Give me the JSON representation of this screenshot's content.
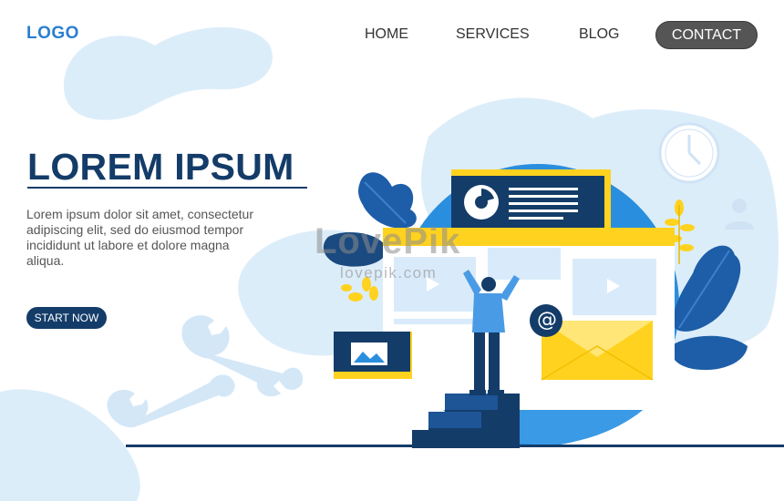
{
  "header": {
    "logo": "LOGO",
    "nav": {
      "home": "HOME",
      "services": "SERVICES",
      "blog": "BLOG",
      "contact": "CONTACT"
    }
  },
  "hero": {
    "title": "LOREM IPSUM",
    "body": "Lorem ipsum dolor sit amet, consectetur adipiscing elit, sed do eiusmod tempor incididunt ut labore et dolore magna aliqua.",
    "cta": "START NOW"
  },
  "illustration": {
    "email_symbol": "@",
    "icons": [
      "wrench-icon",
      "clock-icon",
      "user-icon",
      "envelope-icon",
      "image-icon",
      "chart-icon",
      "play-icon"
    ]
  },
  "watermark": {
    "brand": "LovePik",
    "domain": "lovepik.com"
  },
  "colors": {
    "navy": "#143c69",
    "blue": "#2a7fd0",
    "light_blue": "#dcedfa",
    "yellow": "#ffd21f",
    "button_gray": "#555555"
  }
}
